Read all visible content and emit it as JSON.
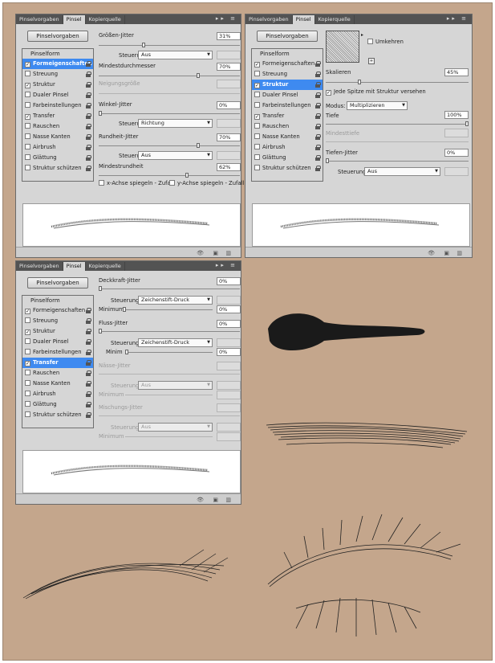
{
  "tabs": {
    "presets": "Pinselvorgaben",
    "brush": "Pinsel",
    "clone": "Kopierquelle"
  },
  "preset_button": "Pinselvorgaben",
  "list_header": "Pinselform",
  "list_items": [
    "Formeigenschaften",
    "Streuung",
    "Struktur",
    "Dualer Pinsel",
    "Farbeinstellungen",
    "Transfer",
    "Rauschen",
    "Nasse Kanten",
    "Airbrush",
    "Glättung",
    "Struktur schützen"
  ],
  "panel1": {
    "size_jitter": "Größen-Jitter",
    "size_jitter_val": "31%",
    "control": "Steuerung:",
    "control_val_off": "Aus",
    "min_diameter": "Mindestdurchmesser",
    "min_diameter_val": "70%",
    "tilt_scale": "Neigungsgröße",
    "angle_jitter": "Winkel-Jitter",
    "angle_jitter_val": "0%",
    "control_val_dir": "Richtung",
    "roundness_jitter": "Rundheit-Jitter",
    "roundness_jitter_val": "70%",
    "min_roundness": "Mindestrundheit",
    "min_roundness_val": "62%",
    "flip_x": "x-Achse spiegeln - Zufall",
    "flip_y": "y-Achse spiegeln - Zufall"
  },
  "panel2": {
    "invert": "Umkehren",
    "scale": "Skalieren",
    "scale_val": "45%",
    "texture_each_tip": "Jede Spitze mit Struktur versehen",
    "mode": "Modus:",
    "mode_val": "Multiplizieren",
    "depth": "Tiefe",
    "depth_val": "100%",
    "min_depth": "Mindesttiefe",
    "depth_jitter": "Tiefen-Jitter",
    "depth_jitter_val": "0%",
    "control": "Steuerung:",
    "control_val": "Aus"
  },
  "panel3": {
    "opacity_jitter": "Deckkraft-Jitter",
    "opacity_jitter_val": "0%",
    "control": "Steuerung:",
    "control_val_pen": "Zeichenstift-Druck",
    "minimum": "Minimum",
    "minimum_val": "0%",
    "flow_jitter": "Fluss-Jitter",
    "flow_jitter_val": "0%",
    "minimum_short": "Minim",
    "minimum2_val": "0%",
    "wet_jitter": "Nässe-Jitter",
    "control_val_off": "Aus",
    "mix_jitter": "Mischungs-Jitter"
  },
  "colors": {
    "background": "#c4a68c",
    "selected": "#3e8af0",
    "tabbar": "#535353",
    "panel": "#d6d6d6"
  }
}
